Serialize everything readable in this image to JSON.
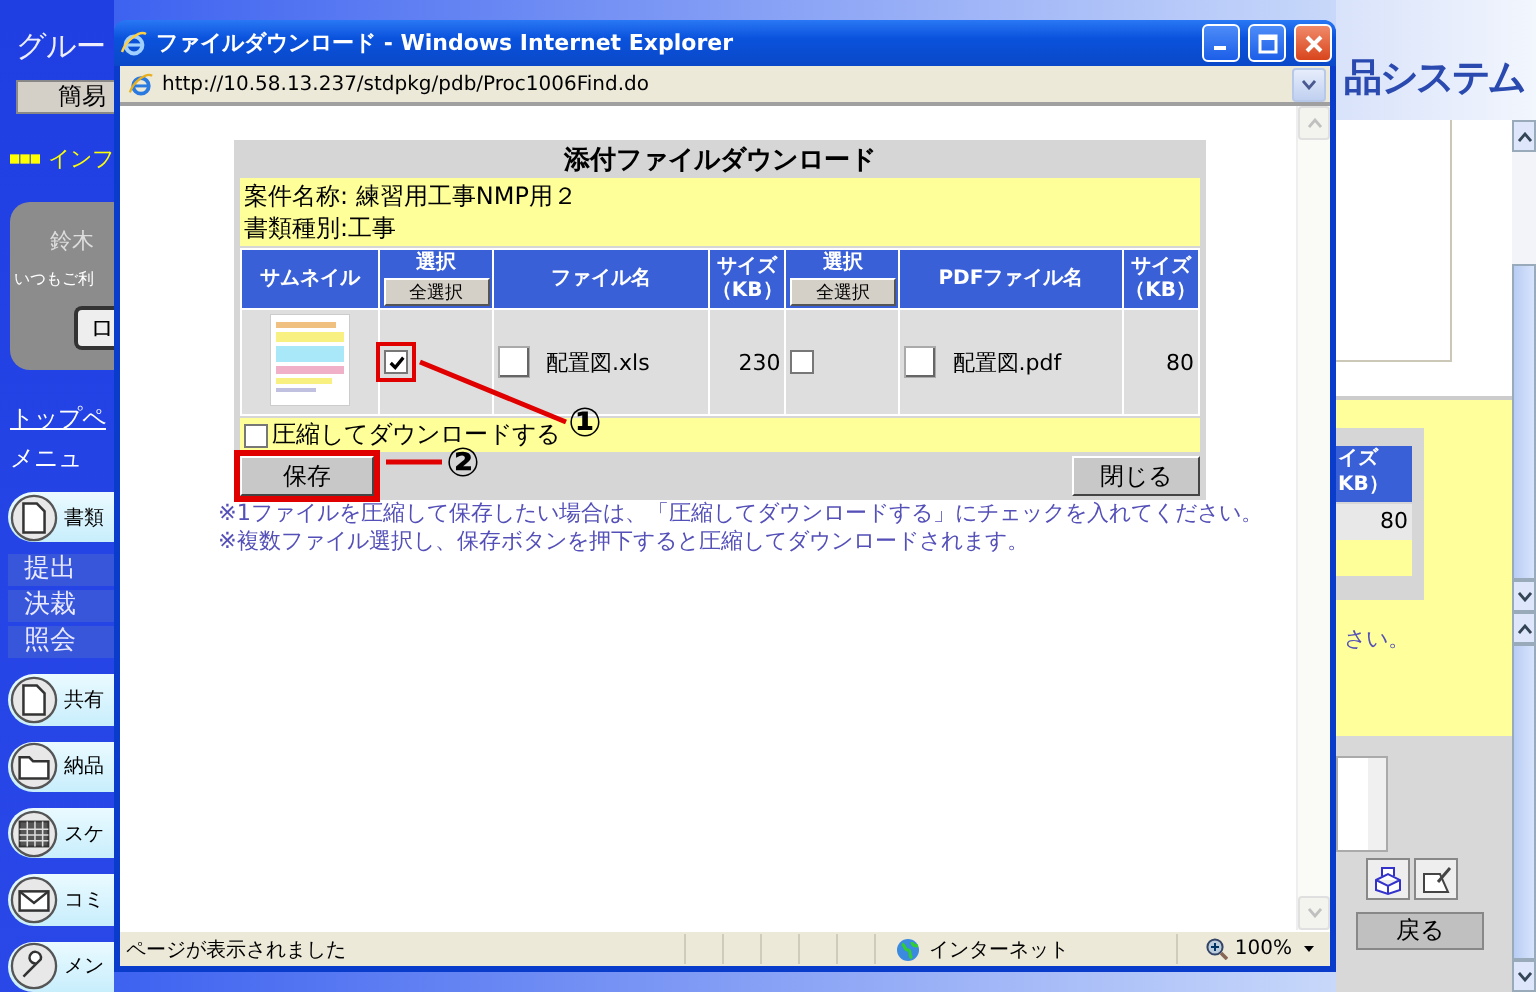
{
  "background_page": {
    "group_label": "グルー",
    "menu_button": "簡易",
    "info_heading": "インフ",
    "user_card": {
      "name": "鈴木",
      "greeting": "いつもご利",
      "button": "ロ"
    },
    "links": [
      "トップペ",
      "メニュ"
    ],
    "menu_groups": [
      {
        "label": "書類",
        "kind": "document",
        "items": [
          "提出",
          "決裁",
          "照会"
        ]
      },
      {
        "label": "共有",
        "kind": "document"
      },
      {
        "label": "納品",
        "kind": "folder"
      },
      {
        "label": "スケ",
        "kind": "calendar"
      },
      {
        "label": "コミ",
        "kind": "mail"
      },
      {
        "label": "メン",
        "kind": "wrench"
      }
    ],
    "logo": "品システム",
    "table_header": [
      "イズ",
      "KB）"
    ],
    "table_value": "80",
    "note_tail": "さい。",
    "back_button": "戻る"
  },
  "window": {
    "title": "ファイルダウンロード - Windows Internet Explorer",
    "address": "http://10.58.13.237/stdpkg/pdb/Proc1006Find.do",
    "status": {
      "text": "ページが表示されました",
      "zone": "インターネット",
      "zoom": "100%"
    }
  },
  "dialog": {
    "title": "添付ファイルダウンロード",
    "case_name": "案件名称: 練習用工事NMP用２",
    "document_type": "書類種別:工事",
    "columns": [
      {
        "kind": "text",
        "lines": [
          "サムネイル"
        ]
      },
      {
        "kind": "select",
        "lines": [
          "選択"
        ],
        "button": "全選択"
      },
      {
        "kind": "text",
        "lines": [
          "ファイル名"
        ]
      },
      {
        "kind": "text",
        "lines": [
          "サイズ",
          "（KB）"
        ]
      },
      {
        "kind": "select",
        "lines": [
          "選択"
        ],
        "button": "全選択"
      },
      {
        "kind": "text",
        "lines": [
          "PDFファイル名"
        ]
      },
      {
        "kind": "text",
        "lines": [
          "サイズ",
          "（KB）"
        ]
      }
    ],
    "rows": [
      {
        "highlighted": true,
        "selected": true,
        "file_name": "配置図.xls",
        "size": "230",
        "pdf_selected": false,
        "pdf_name": "配置図.pdf",
        "pdf_size": "80"
      }
    ],
    "compress": {
      "label": "圧縮してダウンロードする",
      "checked": false
    },
    "save_button": "保存",
    "save_highlighted": true,
    "close_button": "閉じる",
    "annotations": [
      "①",
      "②"
    ],
    "notes": [
      "※1ファイルを圧縮して保存したい場合は、「圧縮してダウンロードする」にチェックを入れてください。",
      "※複数ファイル選択し、保存ボタンを押下すると圧縮してダウンロードされます。"
    ]
  }
}
